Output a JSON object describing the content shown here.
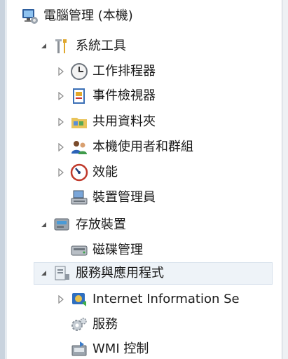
{
  "tree": {
    "root": {
      "label": "電腦管理 (本機)",
      "icon": "computer-management-icon"
    },
    "system_tools": {
      "label": "系統工具",
      "icon": "tools-icon",
      "items": [
        {
          "label": "工作排程器",
          "icon": "clock-icon"
        },
        {
          "label": "事件檢視器",
          "icon": "event-viewer-icon"
        },
        {
          "label": "共用資料夾",
          "icon": "shared-folder-icon"
        },
        {
          "label": "本機使用者和群組",
          "icon": "users-icon"
        },
        {
          "label": "效能",
          "icon": "performance-icon"
        },
        {
          "label": "裝置管理員",
          "icon": "device-manager-icon"
        }
      ]
    },
    "storage": {
      "label": "存放裝置",
      "icon": "storage-icon",
      "items": [
        {
          "label": "磁碟管理",
          "icon": "disk-icon"
        }
      ]
    },
    "services_apps": {
      "label": "服務與應用程式",
      "icon": "services-apps-icon",
      "items": [
        {
          "label": "Internet Information Se",
          "icon": "iis-icon"
        },
        {
          "label": "服務",
          "icon": "gears-icon"
        },
        {
          "label": "WMI 控制",
          "icon": "wmi-icon"
        }
      ]
    }
  },
  "colors": {
    "selection_bg": "#eef3f8",
    "frame": "#c9d3de",
    "text": "#1a1a1a"
  }
}
